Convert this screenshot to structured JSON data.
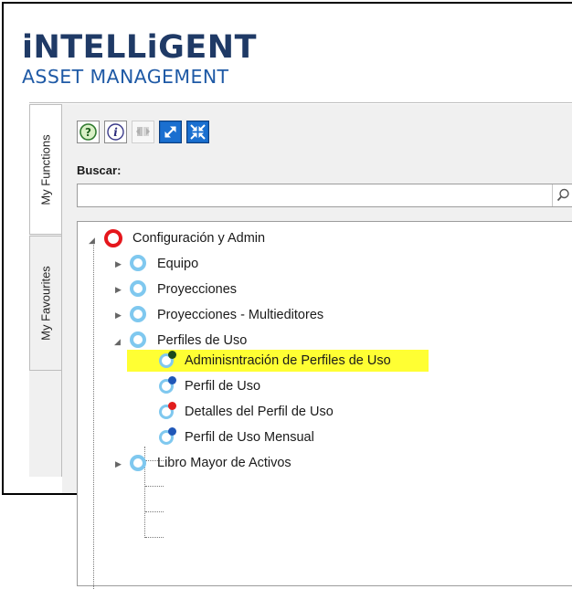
{
  "logo": {
    "line1": "iNTELLiGENT",
    "line2": "ASSET MANAGEMENT"
  },
  "tabs": [
    {
      "label": "My Functions",
      "active": true
    },
    {
      "label": "My Favourites",
      "active": false
    }
  ],
  "toolbar": [
    "help-icon",
    "info-icon",
    "sync-icon",
    "expand-icon",
    "collapse-icon"
  ],
  "search": {
    "label": "Buscar:",
    "value": ""
  },
  "tree": {
    "root": "Configuración y Admin",
    "children": [
      "Equipo",
      "Proyecciones",
      "Proyecciones - Multieditores",
      "Perfiles de Uso",
      "Libro Mayor de Activos"
    ],
    "perfiles_children": [
      {
        "label": "Adminisntración de Perfiles de Uso",
        "dot": "#1b4a1b",
        "selected": true
      },
      {
        "label": "Perfil de Uso",
        "dot": "#1f57b8"
      },
      {
        "label": "Detalles del Perfil de Uso",
        "dot": "#e11d1d"
      },
      {
        "label": "Perfil de Uso Mensual",
        "dot": "#1f57b8"
      }
    ]
  },
  "colors": {
    "highlight": "#ffff33",
    "root_ring": "#e5161c",
    "node_ring": "#7fc8ef"
  }
}
